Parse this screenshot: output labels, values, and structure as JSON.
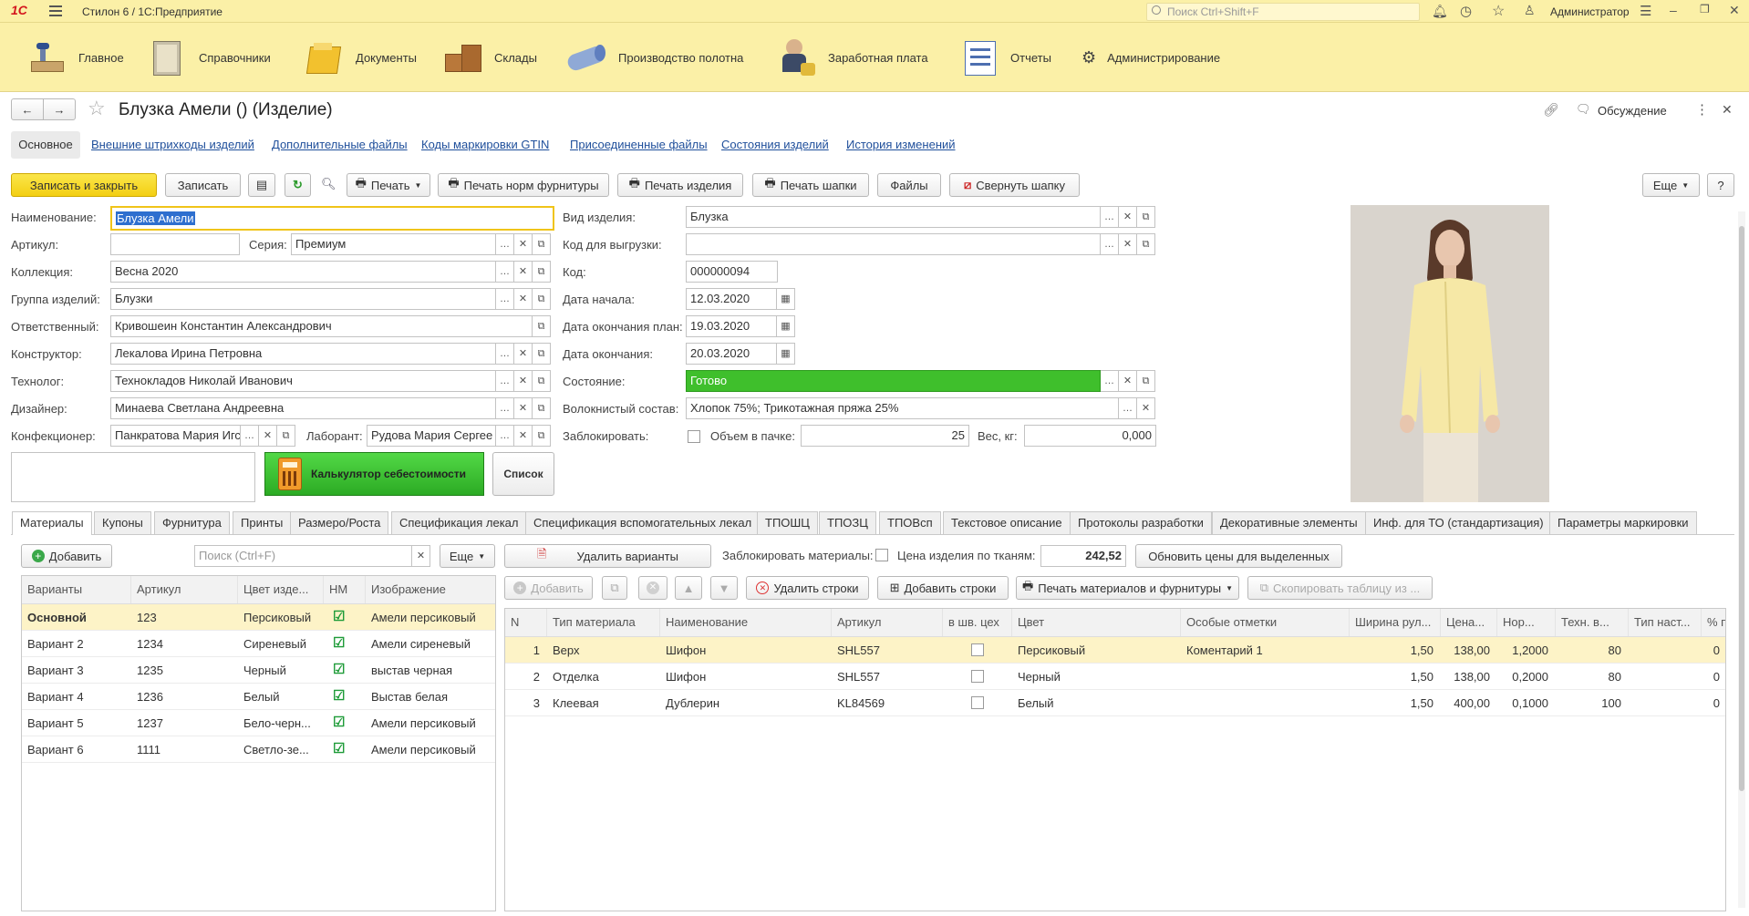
{
  "app": {
    "logo": "1С",
    "title": "Стилон 6 / 1С:Предприятие",
    "search_placeholder": "Поиск Ctrl+Shift+F",
    "user": "Администратор"
  },
  "sections": [
    {
      "label": "Главное",
      "icon": "desk-icon"
    },
    {
      "label": "Справочники",
      "icon": "book-icon"
    },
    {
      "label": "Документы",
      "icon": "folder-icon"
    },
    {
      "label": "Склады",
      "icon": "boxes-icon"
    },
    {
      "label": "Производство полотна",
      "icon": "fabric-roll-icon"
    },
    {
      "label": "Заработная плата",
      "icon": "coins-icon"
    },
    {
      "label": "Отчеты",
      "icon": "report-icon"
    },
    {
      "label": "Администрирование",
      "icon": "gear-icon"
    }
  ],
  "form": {
    "title": "Блузка Амели () (Изделие)",
    "discussion": "Обсуждение"
  },
  "form_tabs": [
    "Основное",
    "Внешние штрихкоды изделий",
    "Дополнительные файлы",
    "Коды маркировки GTIN",
    "Присоединенные файлы",
    "Состояния изделий",
    "История изменений"
  ],
  "toolbar": {
    "save_close": "Записать и закрыть",
    "save": "Записать",
    "print": "Печать",
    "print_norms": "Печать норм фурнитуры",
    "print_item": "Печать изделия",
    "print_header": "Печать шапки",
    "files": "Файлы",
    "collapse": "Свернуть шапку",
    "more": "Еще",
    "help": "?"
  },
  "fields": {
    "name_label": "Наименование:",
    "name": "Блузка Амели",
    "article_label": "Артикул:",
    "article": "",
    "series_label": "Серия:",
    "series": "Премиум",
    "collection_label": "Коллекция:",
    "collection": "Весна 2020",
    "group_label": "Группа изделий:",
    "group": "Блузки",
    "responsible_label": "Ответственный:",
    "responsible": "Кривошеин Константин Александрович",
    "constructor_label": "Конструктор:",
    "constructor": "Лекалова Ирина Петровна",
    "technologist_label": "Технолог:",
    "technologist": "Технокладов Николай Иванович",
    "designer_label": "Дизайнер:",
    "designer": "Минаева Светлана Андреевна",
    "confectioner_label": "Конфекционер:",
    "confectioner": "Панкратова Мария Игс",
    "lab_label": "Лаборант:",
    "lab": "Рудова Мария Сергее",
    "calculator": "Калькулятор себестоимости",
    "list": "Список",
    "type_label": "Вид изделия:",
    "type": "Блузка",
    "export_code_label": "Код для выгрузки:",
    "export_code": "",
    "code_label": "Код:",
    "code": "000000094",
    "start_label": "Дата начала:",
    "start": "12.03.2020",
    "plan_end_label": "Дата окончания план:",
    "plan_end": "19.03.2020",
    "end_label": "Дата окончания:",
    "end": "20.03.2020",
    "state_label": "Состояние:",
    "state": "Готово",
    "fiber_label": "Волокнистый состав:",
    "fiber": "Хлопок 75%; Трикотажная пряжа 25%",
    "block_label": "Заблокировать:",
    "pack_label": "Объем в пачке:",
    "pack": "25",
    "weight_label": "Вес, кг:",
    "weight": "0,000"
  },
  "bottom_tabs": [
    "Материалы",
    "Купоны",
    "Фурнитура",
    "Принты",
    "Размеро/Роста",
    "Спецификация лекал",
    "Спецификация вспомогательных лекал",
    "ТПОШЦ",
    "ТПОЗЦ",
    "ТПОВсп",
    "Текстовое описание",
    "Протоколы разработки",
    "Декоративные элементы",
    "Инф. для ТО (стандартизация)",
    "Параметры маркировки"
  ],
  "variants": {
    "add": "Добавить",
    "search_placeholder": "Поиск (Ctrl+F)",
    "more": "Еще",
    "headers": [
      "Варианты",
      "Артикул",
      "Цвет изде...",
      "НМ",
      "Изображение"
    ],
    "rows": [
      {
        "name": "Основной",
        "article": "123",
        "color": "Персиковый",
        "nm": true,
        "image": "Амели персиковый"
      },
      {
        "name": "Вариант 2",
        "article": "1234",
        "color": "Сиреневый",
        "nm": true,
        "image": "Амели сиреневый"
      },
      {
        "name": "Вариант 3",
        "article": "1235",
        "color": "Черный",
        "nm": true,
        "image": "выстав черная"
      },
      {
        "name": "Вариант 4",
        "article": "1236",
        "color": "Белый",
        "nm": true,
        "image": "Выстав белая"
      },
      {
        "name": "Вариант 5",
        "article": "1237",
        "color": "Бело-черн...",
        "nm": true,
        "image": "Амели персиковый"
      },
      {
        "name": "Вариант 6",
        "article": "1111",
        "color": "Светло-зе...",
        "nm": true,
        "image": "Амели персиковый"
      }
    ]
  },
  "materials": {
    "delete_variants": "Удалить варианты",
    "block_label": "Заблокировать материалы:",
    "price_label": "Цена изделия по тканям:",
    "price": "242,52",
    "update_prices": "Обновить цены для выделенных",
    "add": "Добавить",
    "delete_rows": "Удалить строки",
    "add_rows": "Добавить строки",
    "print": "Печать материалов и фурнитуры",
    "copy": "Скопировать таблицу из ...",
    "headers": [
      "N",
      "Тип материала",
      "Наименование",
      "Артикул",
      "в шв. цех",
      "Цвет",
      "Особые отметки",
      "Ширина рул...",
      "Цена...",
      "Нор...",
      "Техн. в...",
      "Тип наст...",
      "% п"
    ],
    "rows": [
      {
        "n": "1",
        "type": "Верх",
        "name": "Шифон",
        "article": "SHL557",
        "color": "Персиковый",
        "note": "Коментарий 1",
        "width": "1,50",
        "price": "138,00",
        "norm": "1,2000",
        "tech": "80",
        "pct": "0"
      },
      {
        "n": "2",
        "type": "Отделка",
        "name": "Шифон",
        "article": "SHL557",
        "color": "Черный",
        "note": "",
        "width": "1,50",
        "price": "138,00",
        "norm": "0,2000",
        "tech": "80",
        "pct": "0"
      },
      {
        "n": "3",
        "type": "Клеевая",
        "name": "Дублерин",
        "article": "KL84569",
        "color": "Белый",
        "note": "",
        "width": "1,50",
        "price": "400,00",
        "norm": "0,1000",
        "tech": "100",
        "pct": "0"
      }
    ]
  },
  "colors": {
    "accent": "#f3cf13",
    "bar": "#fbf0a7",
    "selected_row": "#fdf3c7",
    "state_green": "#3fbf2c",
    "calc_green": "#36c22e"
  }
}
